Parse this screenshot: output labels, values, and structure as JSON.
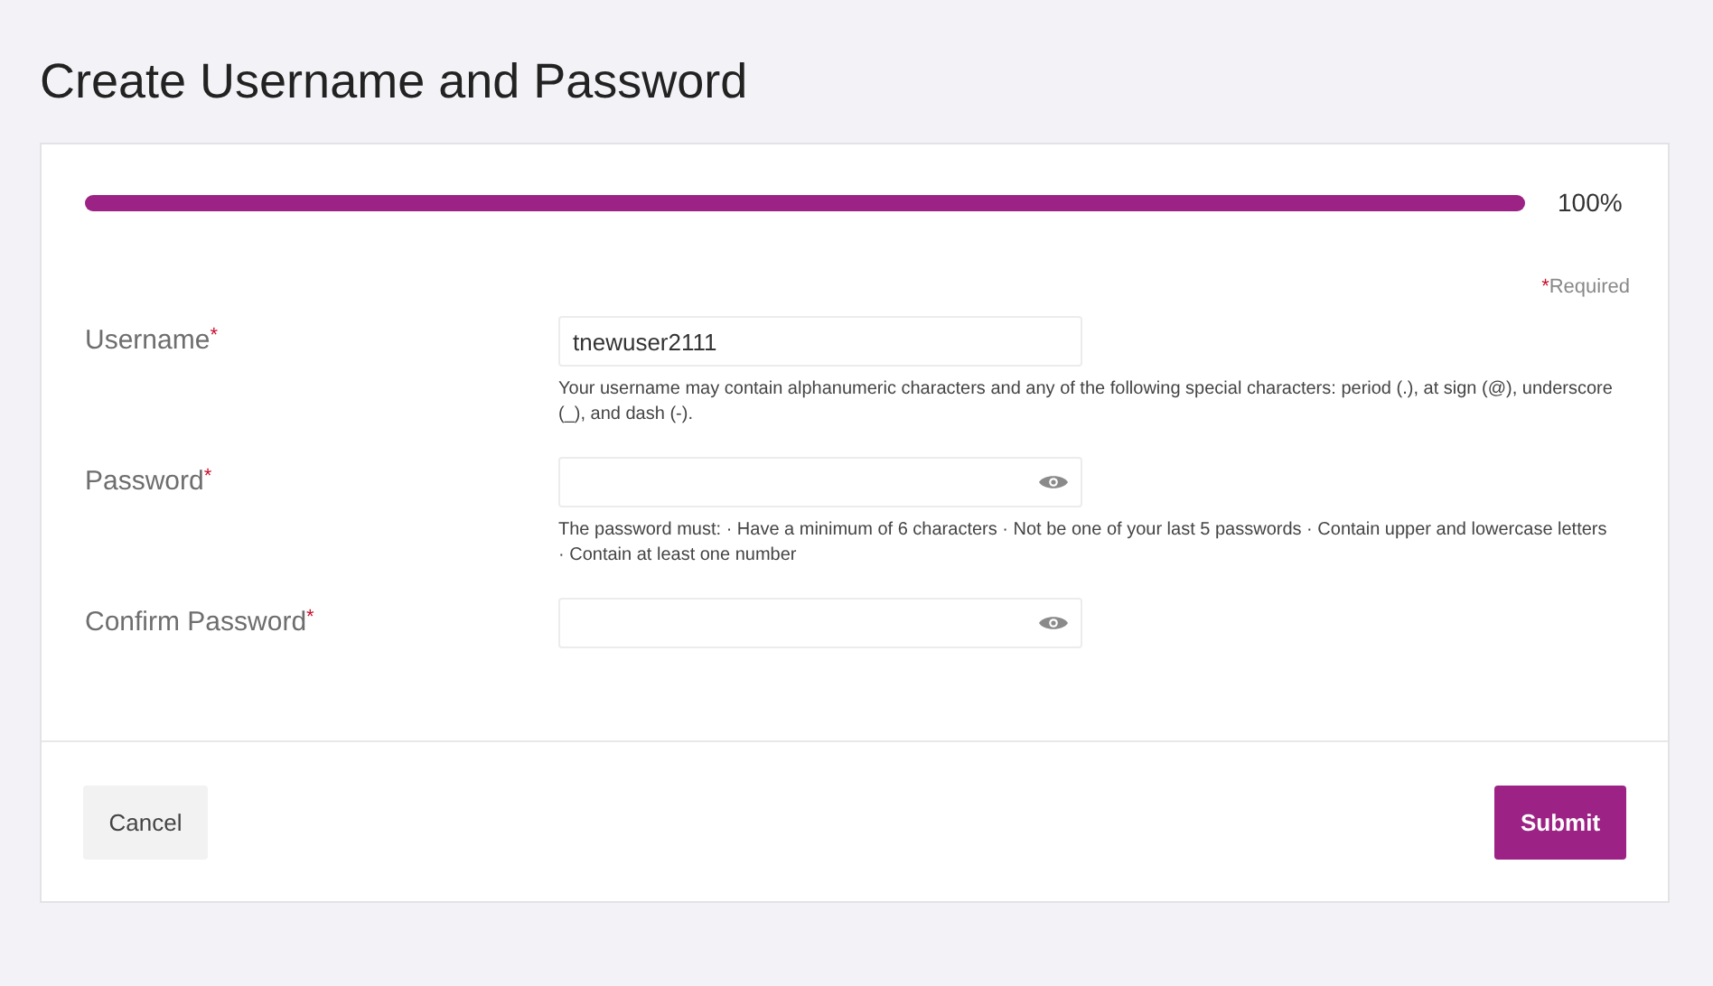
{
  "page": {
    "title": "Create Username and Password"
  },
  "progress": {
    "level": 1.0,
    "reading": "100%"
  },
  "required_note": {
    "mark": "*",
    "text": "Required"
  },
  "fields": [
    {
      "kind": "text",
      "label": "Username",
      "mark": "*",
      "value": "tnewuser2111",
      "help": "Your username may contain alphanumeric characters and any of the following special characters: period (.), at sign (@), underscore (_), and dash (-)."
    },
    {
      "kind": "password",
      "label": "Password",
      "mark": "*",
      "help": "The password must: · Have a minimum of 6 characters · Not be one of your last 5 passwords · Contain upper and lowercase letters · Contain at least one number"
    },
    {
      "kind": "password",
      "label": "Confirm Password",
      "mark": "*"
    }
  ],
  "buttons": {
    "cancel": "Cancel",
    "submit": "Submit"
  }
}
